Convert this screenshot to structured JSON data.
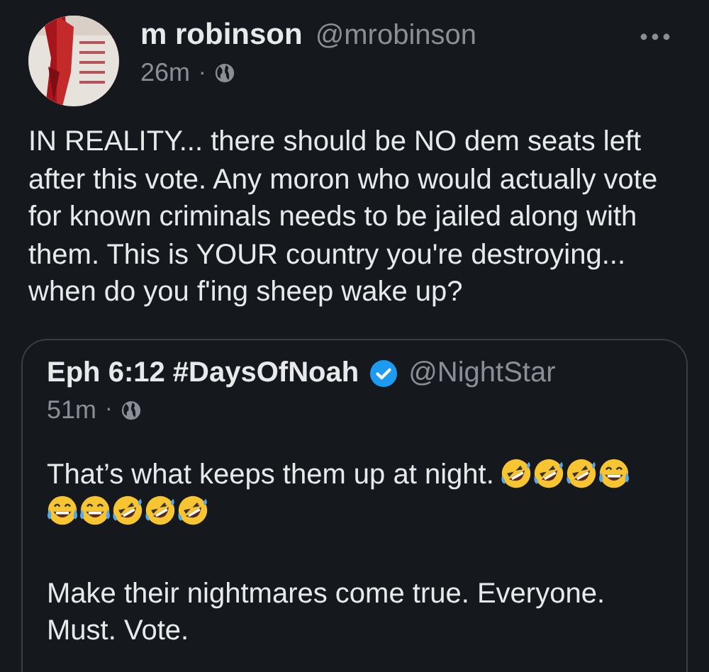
{
  "tweet": {
    "author": {
      "name": "m robinson",
      "handle": "@mrobinson"
    },
    "time": "26m",
    "separator": "·",
    "text": "IN REALITY... there should be NO dem seats left after this vote. Any moron who would actually vote for known criminals needs to be jailed along with them. This is YOUR country you're destroying... when do you f'ing sheep wake up?",
    "quoted": {
      "author": {
        "name": "Eph 6:12 #DaysOfNoah",
        "handle": "@NightStar",
        "verified": true
      },
      "time": "51m",
      "separator": "·",
      "paragraphs": [
        {
          "text": "That’s what keeps them up at night.",
          "emoji": [
            {
              "kind": "rofl"
            },
            {
              "kind": "rofl"
            },
            {
              "kind": "rofl"
            },
            {
              "kind": "joy"
            },
            {
              "kind": "joy"
            },
            {
              "kind": "joy"
            },
            {
              "kind": "rofl"
            },
            {
              "kind": "rofl"
            },
            {
              "kind": "rofl"
            }
          ]
        },
        {
          "text": "Make their nightmares come true. Everyone. Must. Vote."
        }
      ]
    }
  }
}
